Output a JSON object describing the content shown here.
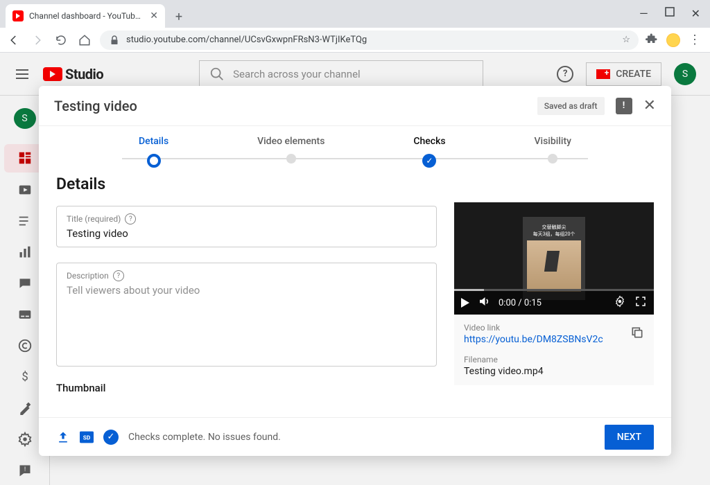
{
  "browser": {
    "tab_title": "Channel dashboard - YouTube St",
    "url": "studio.youtube.com/channel/UCsvGxwpnFRsN3-WTjIKeTQg"
  },
  "header": {
    "logo_text": "Studio",
    "search_placeholder": "Search across your channel",
    "create_label": "CREATE",
    "avatar_letter": "S"
  },
  "dialog": {
    "title": "Testing video",
    "draft_label": "Saved as draft",
    "steps": [
      "Details",
      "Video elements",
      "Checks",
      "Visibility"
    ],
    "section_heading": "Details",
    "title_field": {
      "label": "Title (required)",
      "value": "Testing video"
    },
    "desc_field": {
      "label": "Description",
      "placeholder": "Tell viewers about your video"
    },
    "thumbnail_heading": "Thumbnail",
    "preview": {
      "caption_line1": "交替触脚尖",
      "caption_line2": "每天3组，每组20个",
      "time": "0:00 / 0:15"
    },
    "meta": {
      "link_label": "Video link",
      "link_value": "https://youtu.be/DM8ZSBNsV2c",
      "filename_label": "Filename",
      "filename_value": "Testing video.mp4"
    },
    "footer_status": "Checks complete. No issues found.",
    "next_label": "NEXT"
  }
}
